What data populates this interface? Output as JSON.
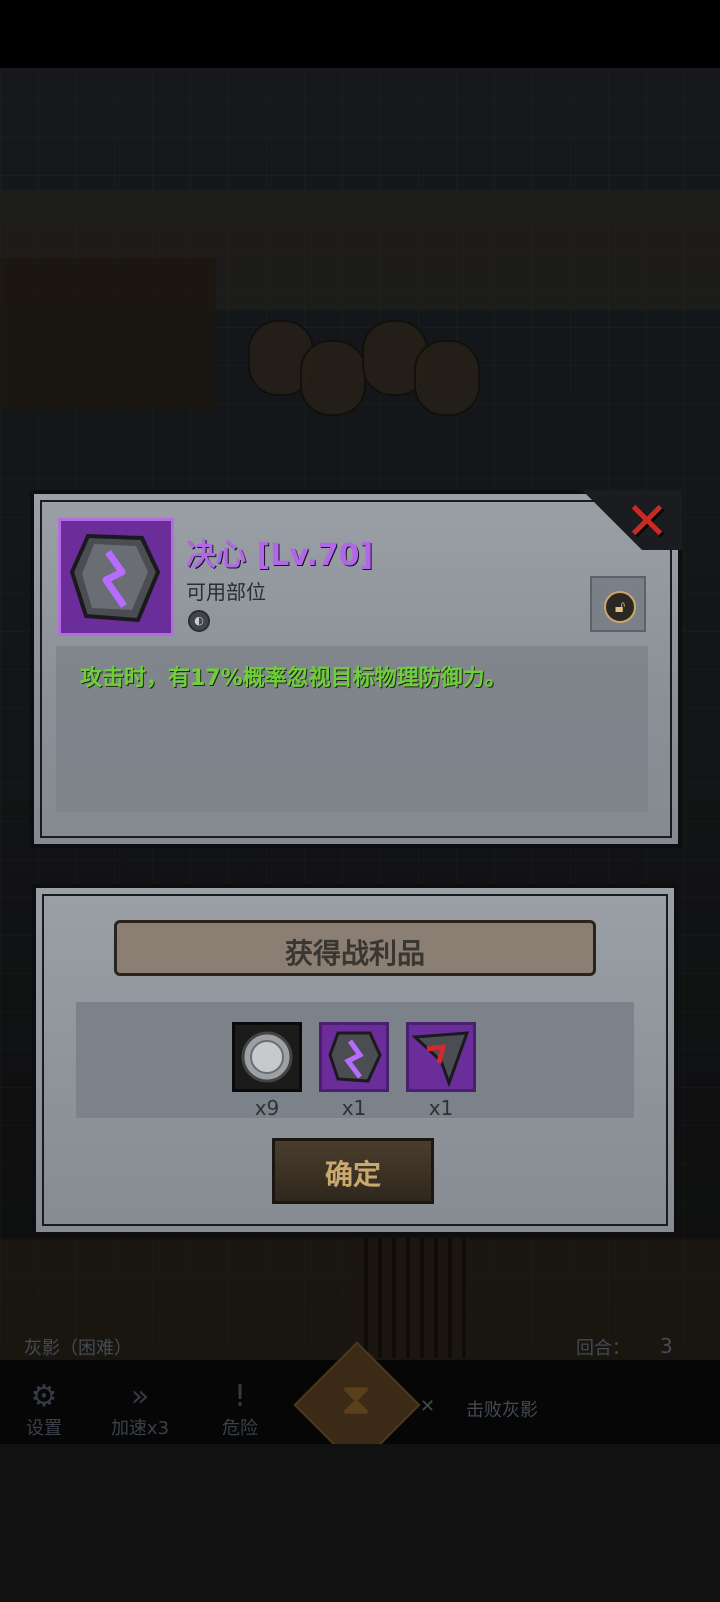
{
  "item": {
    "name": "决心 [Lv.70]",
    "slot_label": "可用部位",
    "description": "攻击时，有17%概率忽视目标物理防御力。",
    "icon": "purple-rune-stone-icon",
    "lock_icon": "unlocked-padlock-icon",
    "close_icon": "red-x-close-icon"
  },
  "loot": {
    "title": "获得战利品",
    "items": [
      {
        "icon": "silver-coin-icon",
        "count": "x9",
        "rarity_color": "#1b1b1b"
      },
      {
        "icon": "purple-rune-stone-icon",
        "count": "x1",
        "rarity_color": "#6a2d9a"
      },
      {
        "icon": "red-arrow-rune-icon",
        "count": "x1",
        "rarity_color": "#6a2d9a"
      }
    ],
    "confirm_label": "确定"
  },
  "hud": {
    "stage_label": "灰影（困难）",
    "round_label": "回合：",
    "round_value": "3",
    "buttons": [
      {
        "label": "设置",
        "icon": "gear-icon"
      },
      {
        "label": "加速x3",
        "icon": "fast-forward-icon"
      },
      {
        "label": "危险",
        "icon": "warning-icon"
      }
    ],
    "objective": "击败灰影"
  },
  "colors": {
    "item_name": "#b268e6",
    "description": "#6fcf3a",
    "close": "#c92a24"
  }
}
